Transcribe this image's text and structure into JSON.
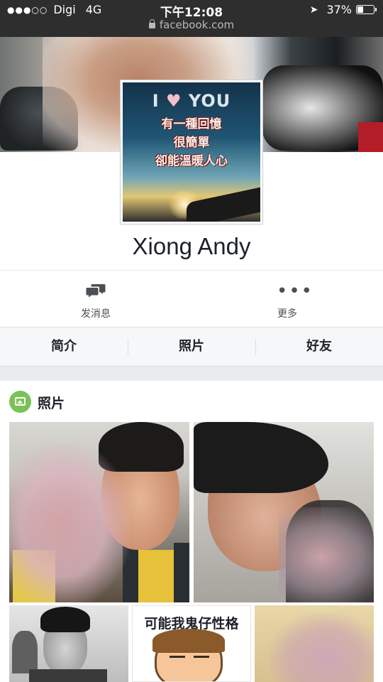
{
  "status_bar": {
    "carrier": "Digi",
    "network": "4G",
    "time": "下午12:08",
    "battery_percent": "37%",
    "battery_level": 0.37,
    "url": "facebook.com"
  },
  "profile": {
    "name": "Xiong Andy",
    "picture_text": {
      "title_left": "I",
      "title_heart": "♥",
      "title_right": "YOU",
      "line1": "有一種回憶",
      "line2": "很簡單",
      "line3": "卻能溫暖人心"
    }
  },
  "actions": {
    "message_label": "发消息",
    "more_label": "更多"
  },
  "tabs": [
    {
      "label": "简介"
    },
    {
      "label": "照片"
    },
    {
      "label": "好友"
    }
  ],
  "photos_section": {
    "title": "照片",
    "photo4_caption": "可能我鬼仔性格"
  },
  "colors": {
    "status_bar_bg": "#2e2e2e",
    "photos_icon_green": "#78c257",
    "tab_bar_bg": "#f6f7f9",
    "separator": "#e9ebee"
  },
  "icons": [
    "lock-icon",
    "location-arrow-icon",
    "battery-icon",
    "message-icon",
    "more-dots-icon",
    "photos-icon"
  ]
}
